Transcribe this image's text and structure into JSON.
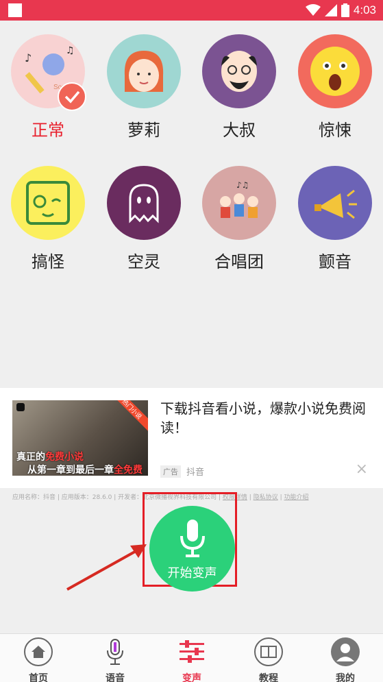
{
  "status_bar": {
    "time": "4:03"
  },
  "effects": [
    {
      "label": "正常",
      "icon": "singer-microphone-icon",
      "bg": "#f8d2d2",
      "selected": true
    },
    {
      "label": "萝莉",
      "icon": "girl-face-icon",
      "bg": "#9fd7d2",
      "selected": false
    },
    {
      "label": "大叔",
      "icon": "uncle-face-icon",
      "bg": "#7b5392",
      "selected": false
    },
    {
      "label": "惊悚",
      "icon": "shocked-emoji-icon",
      "bg": "#f26a5d",
      "selected": false
    },
    {
      "label": "搞怪",
      "icon": "funny-face-icon",
      "bg": "#fbef5d",
      "selected": false
    },
    {
      "label": "空灵",
      "icon": "ghost-icon",
      "bg": "#6a2c5f",
      "selected": false
    },
    {
      "label": "合唱团",
      "icon": "choir-icon",
      "bg": "#d7a6a4",
      "selected": false
    },
    {
      "label": "颤音",
      "icon": "megaphone-icon",
      "bg": "#6c63b6",
      "selected": false
    }
  ],
  "ad": {
    "thumb_tag": "热门小说",
    "thumb_line1_a": "真正的",
    "thumb_line1_b": "免费小说",
    "thumb_line2_a": "从第一章到最后一章",
    "thumb_line2_b": "全免费",
    "title": "下载抖音看小说，爆款小说免费阅读！",
    "ad_label": "广告",
    "advertiser": "抖音",
    "close": "×"
  },
  "meta": {
    "text": "应用名称：抖音 | 应用版本：28.6.0 | 开发者：北京微播视界科技有限公司 |",
    "link1": "权限详情",
    "link2": "隐私协议",
    "link3": "功能介绍"
  },
  "start_button": {
    "label": "开始变声"
  },
  "tabs": [
    {
      "label": "首页",
      "icon": "home-icon",
      "active": false
    },
    {
      "label": "语音",
      "icon": "microphone-icon",
      "active": false
    },
    {
      "label": "变声",
      "icon": "sliders-icon",
      "active": true
    },
    {
      "label": "教程",
      "icon": "book-icon",
      "active": false
    },
    {
      "label": "我的",
      "icon": "profile-icon",
      "active": false
    }
  ],
  "colors": {
    "accent": "#e8374f",
    "start_green": "#2bd17a",
    "highlight_box": "#e41e26"
  }
}
